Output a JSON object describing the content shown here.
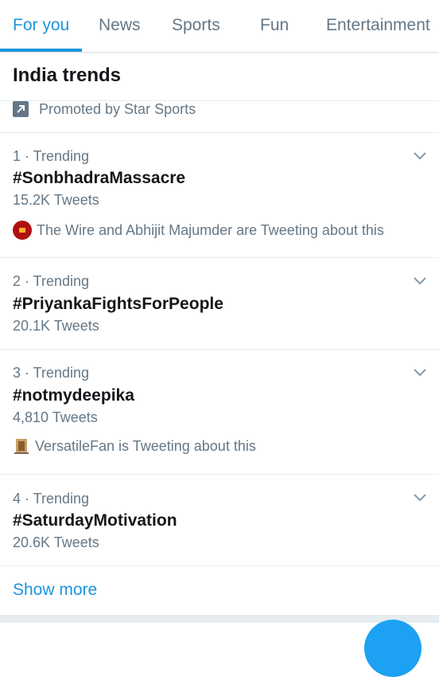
{
  "tabs": [
    "For you",
    "News",
    "Sports",
    "Fun",
    "Entertainment"
  ],
  "active_tab": "For you",
  "colors": {
    "accent": "#1b95e0",
    "secondary_text": "#657786",
    "divider": "#e6ecf0"
  },
  "section_title": "India trends",
  "promoted": {
    "text": "Promoted by Star Sports",
    "icon": "arrow-up-right-icon"
  },
  "trends": [
    {
      "meta": "1 · Trending",
      "name": "#SonbhadraMassacre",
      "count": "15.2K Tweets",
      "context": "The Wire and Abhijit Majumder are Tweeting about this",
      "context_icon": "red-avatar-icon"
    },
    {
      "meta": "2 · Trending",
      "name": "#PriyankaFightsForPeople",
      "count": "20.1K Tweets"
    },
    {
      "meta": "3 · Trending",
      "name": "#notmydeepika",
      "count": "4,810 Tweets",
      "context": "VersatileFan is Tweeting about this",
      "context_icon": "door-avatar-icon"
    },
    {
      "meta": "4 · Trending",
      "name": "#SaturdayMotivation",
      "count": "20.6K Tweets"
    }
  ],
  "show_more": "Show more"
}
